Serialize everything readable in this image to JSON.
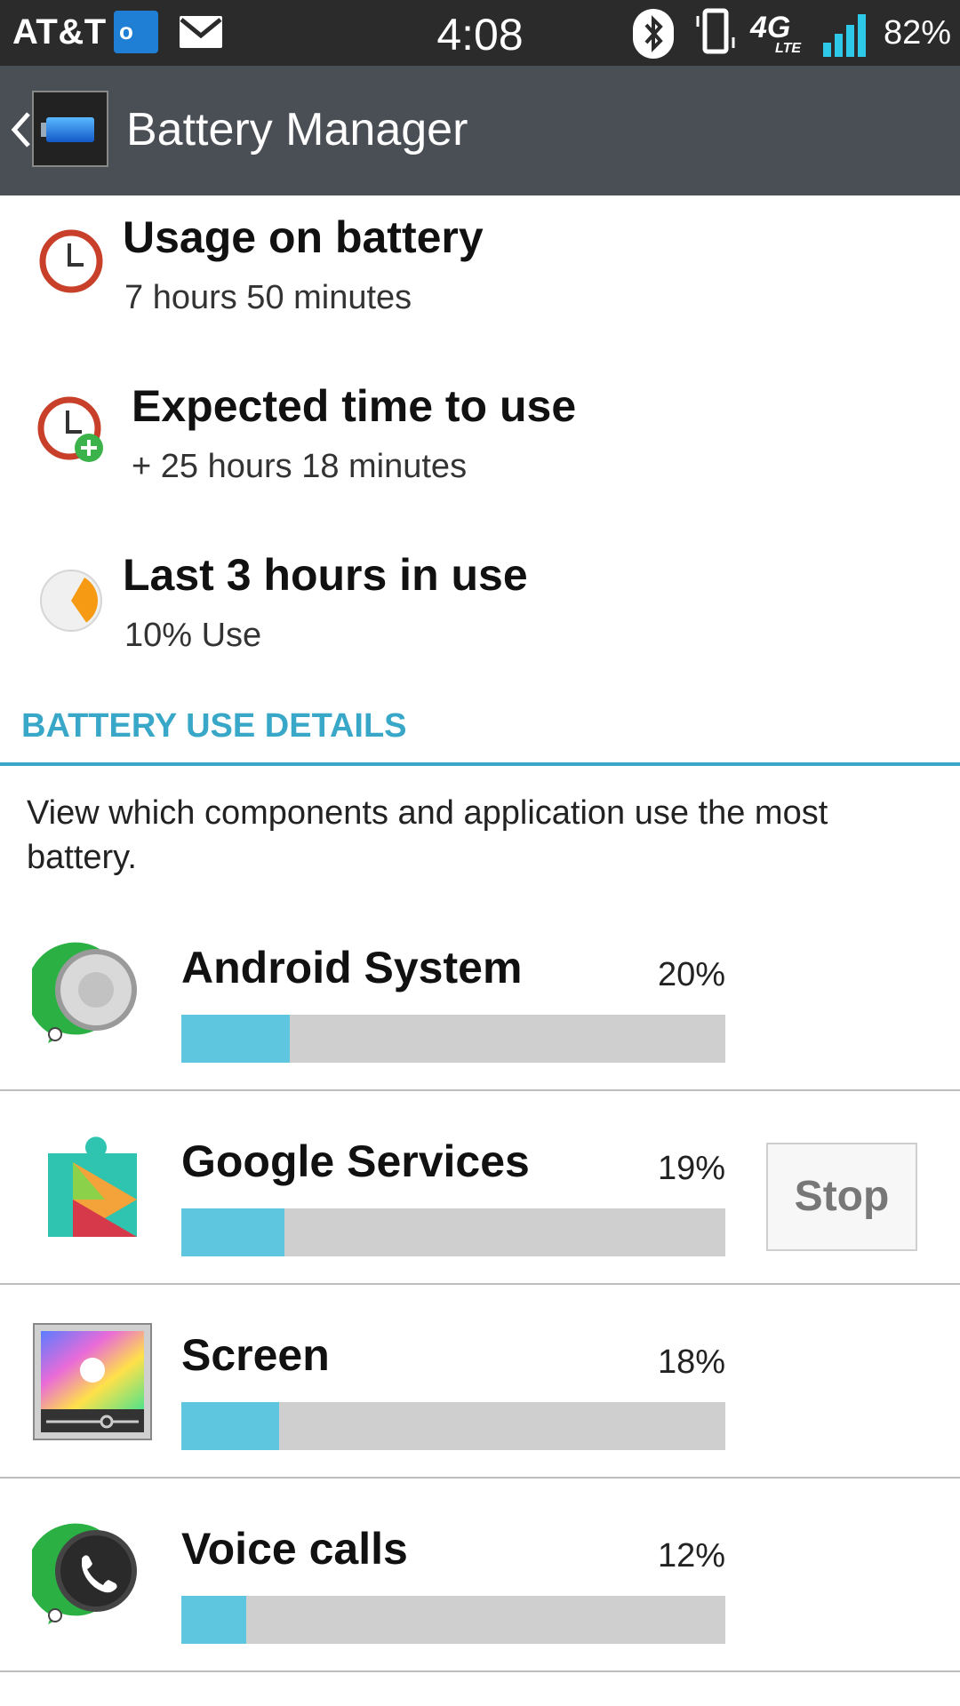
{
  "status_bar": {
    "carrier": "AT&T",
    "outlook_label": "o",
    "time": "4:08",
    "network": "4G",
    "network_sub": "LTE",
    "battery": "82%"
  },
  "action_bar": {
    "title": "Battery Manager"
  },
  "summary": [
    {
      "title": "Usage on battery",
      "value": "7 hours 50 minutes",
      "icon": "clock-icon"
    },
    {
      "title": "Expected time to use",
      "value": "+ 25 hours 18 minutes",
      "icon": "clock-plus-icon"
    },
    {
      "title": "Last 3 hours in use",
      "value": "10% Use",
      "icon": "pie-chart-icon",
      "use_percent": 10
    }
  ],
  "details": {
    "header": "BATTERY USE DETAILS",
    "description": "View which components and application use the most battery."
  },
  "apps": [
    {
      "name": "Android System",
      "percent_label": "20%",
      "percent": 20,
      "icon": "android-system-icon"
    },
    {
      "name": "Google Services",
      "percent_label": "19%",
      "percent": 19,
      "icon": "google-services-icon",
      "stop_label": "Stop"
    },
    {
      "name": "Screen",
      "percent_label": "18%",
      "percent": 18,
      "icon": "screen-icon"
    },
    {
      "name": "Voice calls",
      "percent_label": "12%",
      "percent": 12,
      "icon": "voice-calls-icon"
    }
  ],
  "colors": {
    "accent": "#38a7c8",
    "bar_fill": "#5ec6de",
    "bar_track": "#cfcfcf",
    "action_bar": "#4a4f55"
  }
}
